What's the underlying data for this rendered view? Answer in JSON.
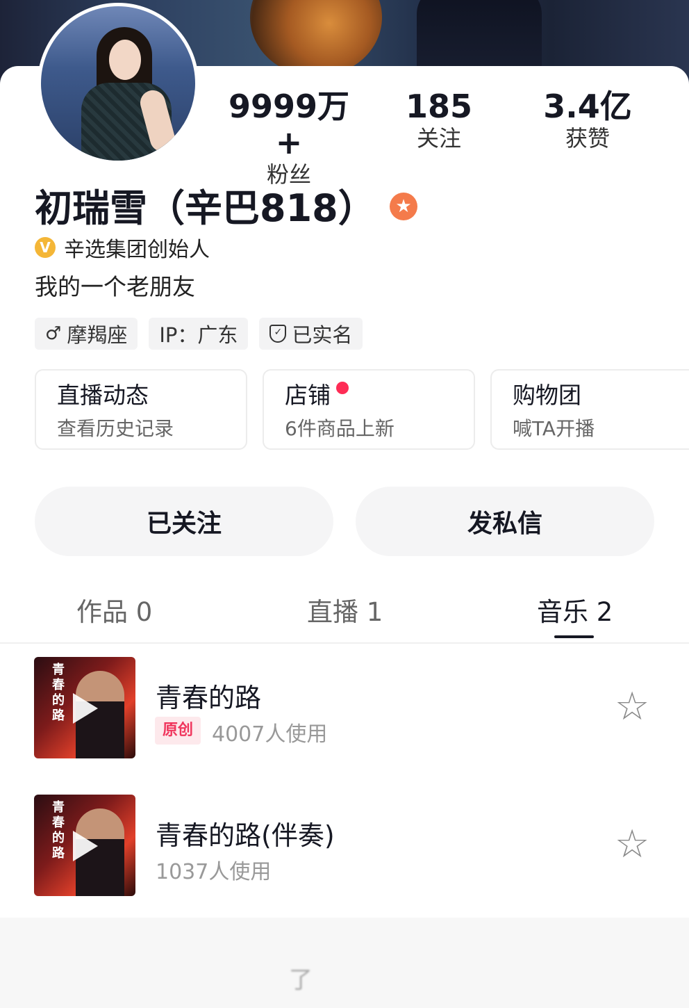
{
  "stats": [
    {
      "value": "9999万+",
      "label": "粉丝"
    },
    {
      "value": "185",
      "label": "关注"
    },
    {
      "value": "3.4亿",
      "label": "获赞"
    }
  ],
  "profile": {
    "name": "初瑞雪（辛巴818）",
    "verify_text": "辛选集团创始人",
    "bio": "我的一个老朋友",
    "star_icon": "★"
  },
  "tags": [
    "摩羯座",
    "IP：广东",
    "已实名"
  ],
  "features": [
    {
      "title": "直播动态",
      "sub": "查看历史记录"
    },
    {
      "title": "店铺",
      "sub": "6件商品上新"
    },
    {
      "title": "购物团",
      "sub": "喊TA开播"
    }
  ],
  "buttons": {
    "follow": "已关注",
    "message": "发私信"
  },
  "tabs": [
    "作品 0",
    "直播 1",
    "音乐 2"
  ],
  "songs": [
    {
      "title": "青春的路",
      "badge": "原创",
      "usage": "4007人使用",
      "cover_text": "青春的路"
    },
    {
      "title": "青春的路(伴奏)",
      "usage": "1037人使用",
      "cover_text": "青春的路"
    }
  ],
  "footer_text": "了"
}
